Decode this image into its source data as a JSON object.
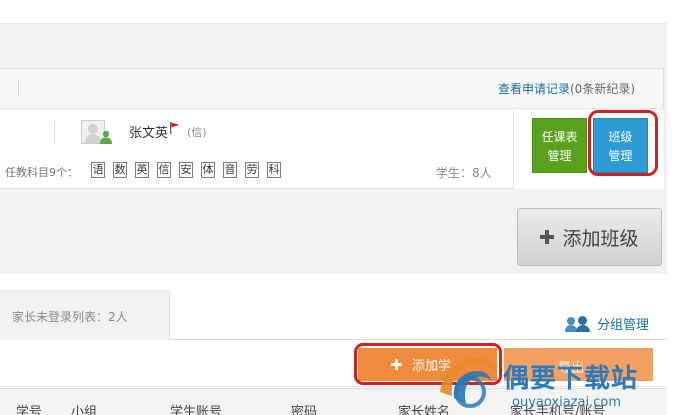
{
  "card": {
    "apply_link": "查看申请记录",
    "apply_pending": "(0条新纪录)",
    "teacher_name": "张文英",
    "teacher_tag": "(信)",
    "subjects_label": "任教科目9个：",
    "subjects": [
      "语",
      "数",
      "英",
      "信",
      "安",
      "体",
      "音",
      "劳",
      "科"
    ],
    "students_count": "学生：8人",
    "schedule_btn_line1": "任课表",
    "schedule_btn_line2": "管理",
    "class_btn_line1": "班级",
    "class_btn_line2": "管理"
  },
  "add_class_btn": "添加班级",
  "lower": {
    "tab_unlogged": "家长未登录列表：2人",
    "group_manage": "分组管理",
    "add_student_btn": "添加学",
    "export_btn": "导出",
    "columns": [
      "学号",
      "小组",
      "学生账号",
      "密码",
      "家长姓名",
      "家长手机号/账号"
    ]
  },
  "watermark": {
    "text": "偶要下载站",
    "url": "ouyaoxiazai.com"
  },
  "colors": {
    "green_btn": "#5aa11c",
    "blue_btn": "#2d9bd5",
    "orange_btn": "#f08a3c",
    "highlight": "#cc2222",
    "link": "#1b6e9e"
  }
}
